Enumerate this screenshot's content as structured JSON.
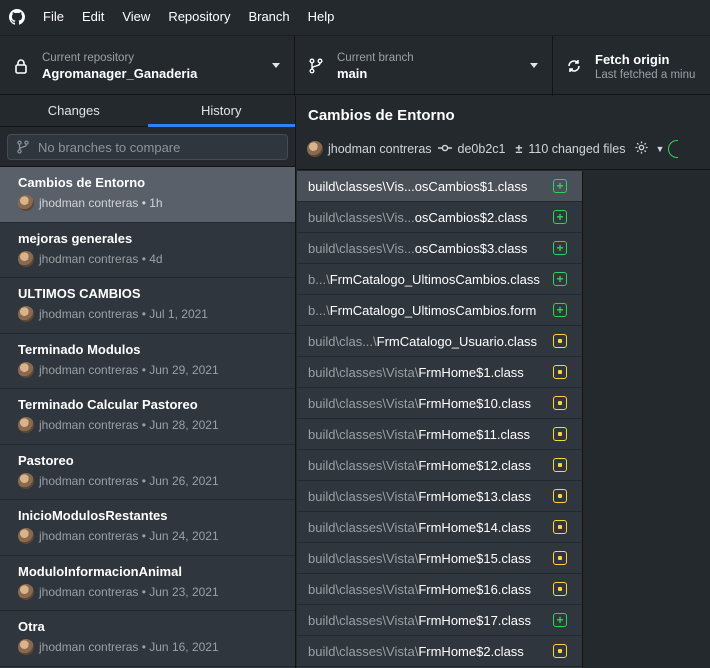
{
  "menubar": {
    "items": [
      "File",
      "Edit",
      "View",
      "Repository",
      "Branch",
      "Help"
    ]
  },
  "toolbar": {
    "repo": {
      "label": "Current repository",
      "value": "Agromanager_Ganaderia"
    },
    "branch": {
      "label": "Current branch",
      "value": "main"
    },
    "fetch": {
      "label": "Fetch origin",
      "sub": "Last fetched a minu"
    }
  },
  "sidebar": {
    "tabs": [
      "Changes",
      "History"
    ],
    "selected_tab": "History",
    "compare_placeholder": "No branches to compare",
    "commits": [
      {
        "title": "Cambios de Entorno",
        "meta": "jhodman contreras • 1h",
        "selected": true
      },
      {
        "title": "mejoras generales",
        "meta": "jhodman contreras • 4d"
      },
      {
        "title": "ULTIMOS CAMBIOS",
        "meta": "jhodman contreras • Jul 1, 2021"
      },
      {
        "title": "Terminado Modulos",
        "meta": "jhodman contreras • Jun 29, 2021"
      },
      {
        "title": "Terminado Calcular Pastoreo",
        "meta": "jhodman contreras • Jun 28, 2021"
      },
      {
        "title": "Pastoreo",
        "meta": "jhodman contreras • Jun 26, 2021"
      },
      {
        "title": "InicioModulosRestantes",
        "meta": "jhodman contreras • Jun 24, 2021"
      },
      {
        "title": "ModuloInformacionAnimal",
        "meta": "jhodman contreras • Jun 23, 2021"
      },
      {
        "title": "Otra",
        "meta": "jhodman contreras • Jun 16, 2021"
      }
    ]
  },
  "main": {
    "title": "Cambios de Entorno",
    "author": "jhodman contreras",
    "sha": "de0b2c1",
    "changed_files": "110 changed files",
    "files": [
      {
        "prefix": "build\\classes\\Vis...",
        "name": "osCambios$1.class",
        "status": "added",
        "selected": true
      },
      {
        "prefix": "build\\classes\\Vis...",
        "name": "osCambios$2.class",
        "status": "added"
      },
      {
        "prefix": "build\\classes\\Vis...",
        "name": "osCambios$3.class",
        "status": "added"
      },
      {
        "prefix": "b...\\",
        "name": "FrmCatalogo_UltimosCambios.class",
        "status": "added"
      },
      {
        "prefix": "b...\\",
        "name": "FrmCatalogo_UltimosCambios.form",
        "status": "added"
      },
      {
        "prefix": "build\\clas...\\",
        "name": "FrmCatalogo_Usuario.class",
        "status": "modified"
      },
      {
        "prefix": "build\\classes\\Vista\\",
        "name": "FrmHome$1.class",
        "status": "modified"
      },
      {
        "prefix": "build\\classes\\Vista\\",
        "name": "FrmHome$10.class",
        "status": "modified"
      },
      {
        "prefix": "build\\classes\\Vista\\",
        "name": "FrmHome$11.class",
        "status": "modified"
      },
      {
        "prefix": "build\\classes\\Vista\\",
        "name": "FrmHome$12.class",
        "status": "modified"
      },
      {
        "prefix": "build\\classes\\Vista\\",
        "name": "FrmHome$13.class",
        "status": "modified"
      },
      {
        "prefix": "build\\classes\\Vista\\",
        "name": "FrmHome$14.class",
        "status": "modified"
      },
      {
        "prefix": "build\\classes\\Vista\\",
        "name": "FrmHome$15.class",
        "status": "modified"
      },
      {
        "prefix": "build\\classes\\Vista\\",
        "name": "FrmHome$16.class",
        "status": "modified"
      },
      {
        "prefix": "build\\classes\\Vista\\",
        "name": "FrmHome$17.class",
        "status": "added"
      },
      {
        "prefix": "build\\classes\\Vista\\",
        "name": "FrmHome$2.class",
        "status": "modified"
      }
    ]
  },
  "colors": {
    "added": "#34d058",
    "modified": "#ffd33d",
    "accent": "#2f81f7"
  }
}
